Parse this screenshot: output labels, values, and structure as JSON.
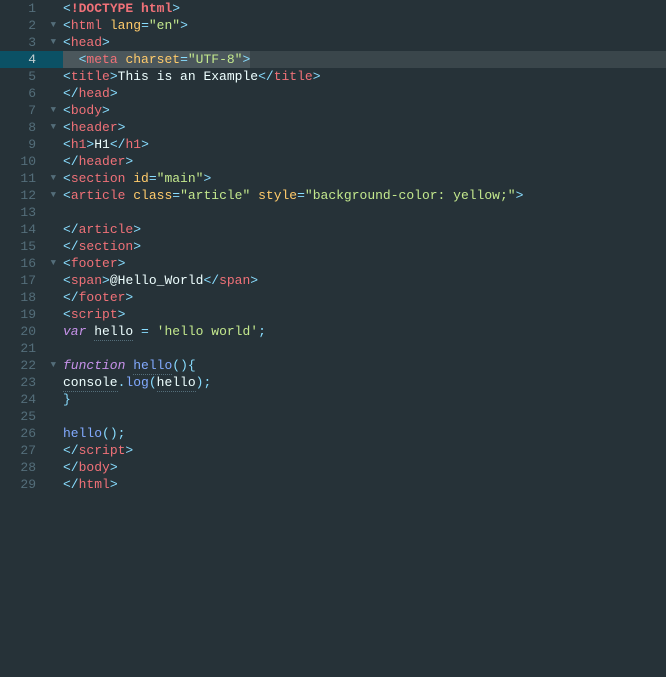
{
  "activeLine": 4,
  "gutter": [
    {
      "n": "1",
      "fold": ""
    },
    {
      "n": "2",
      "fold": "▼"
    },
    {
      "n": "3",
      "fold": "▼"
    },
    {
      "n": "4",
      "fold": ""
    },
    {
      "n": "5",
      "fold": ""
    },
    {
      "n": "6",
      "fold": ""
    },
    {
      "n": "7",
      "fold": "▼"
    },
    {
      "n": "8",
      "fold": "▼"
    },
    {
      "n": "9",
      "fold": ""
    },
    {
      "n": "10",
      "fold": ""
    },
    {
      "n": "11",
      "fold": "▼"
    },
    {
      "n": "12",
      "fold": "▼"
    },
    {
      "n": "13",
      "fold": ""
    },
    {
      "n": "14",
      "fold": ""
    },
    {
      "n": "15",
      "fold": ""
    },
    {
      "n": "16",
      "fold": "▼"
    },
    {
      "n": "17",
      "fold": ""
    },
    {
      "n": "18",
      "fold": ""
    },
    {
      "n": "19",
      "fold": ""
    },
    {
      "n": "20",
      "fold": ""
    },
    {
      "n": "21",
      "fold": ""
    },
    {
      "n": "22",
      "fold": "▼"
    },
    {
      "n": "23",
      "fold": ""
    },
    {
      "n": "24",
      "fold": ""
    },
    {
      "n": "25",
      "fold": ""
    },
    {
      "n": "26",
      "fold": ""
    },
    {
      "n": "27",
      "fold": ""
    },
    {
      "n": "28",
      "fold": ""
    },
    {
      "n": "29",
      "fold": ""
    }
  ],
  "tokens": {
    "doctype": "!DOCTYPE",
    "html_kw": "html",
    "lang": "lang",
    "en": "\"en\"",
    "head": "head",
    "meta": "meta",
    "charset": "charset",
    "utf8": "\"UTF-8\"",
    "title": "title",
    "title_text": "This is an Example",
    "body": "body",
    "header": "header",
    "h1": "h1",
    "h1_text": "H1",
    "section": "section",
    "id": "id",
    "main": "\"main\"",
    "article": "article",
    "class": "class",
    "article_str": "\"article\"",
    "style": "style",
    "bg": "\"background-color: yellow;\"",
    "footer": "footer",
    "span": "span",
    "hello_world": "@Hello_World",
    "script": "script",
    "var": "var",
    "hello": "hello",
    "eq": "=",
    "hw_str": "'hello world'",
    "semi": ";",
    "function": "function",
    "paren_l": "(",
    "paren_r": ")",
    "brace_l": "{",
    "brace_r": "}",
    "console": "console",
    "dot": ".",
    "log": "log"
  }
}
